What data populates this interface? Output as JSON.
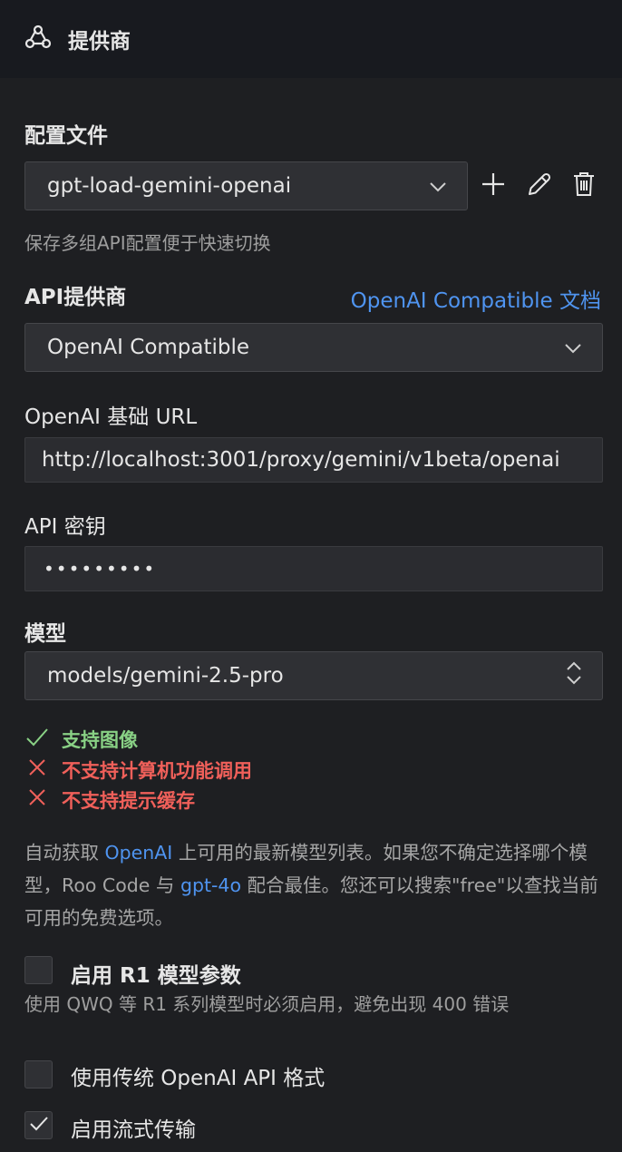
{
  "header": {
    "title": "提供商",
    "icon": "webhook-icon"
  },
  "config_file": {
    "label": "配置文件",
    "selected": "gpt-load-gemini-openai",
    "hint": "保存多组API配置便于快速切换"
  },
  "api_provider": {
    "label": "API提供商",
    "doc_link": "OpenAI Compatible 文档",
    "selected": "OpenAI Compatible"
  },
  "base_url": {
    "label": "OpenAI 基础 URL",
    "value": "http://localhost:3001/proxy/gemini/v1beta/openai"
  },
  "api_key": {
    "label": "API 密钥",
    "value": "•••••••••"
  },
  "model": {
    "label": "模型",
    "selected": "models/gemini-2.5-pro"
  },
  "capabilities": [
    {
      "text": "支持图像",
      "supported": true,
      "color": "#89d185"
    },
    {
      "text": "不支持计算机功能调用",
      "supported": false,
      "color": "#f0605a"
    },
    {
      "text": "不支持提示缓存",
      "supported": false,
      "color": "#f0605a"
    }
  ],
  "description": {
    "p1": "自动获取 ",
    "link1": "OpenAI",
    "p2": " 上可用的最新模型列表。如果您不确定选择哪个模型，Roo Code 与 ",
    "link2": "gpt-4o",
    "p3": " 配合最佳。您还可以搜索\"free\"以查找当前可用的免费选项。"
  },
  "r1": {
    "label": "启用 R1 模型参数",
    "hint": "使用 QWQ 等 R1 系列模型时必须启用，避免出现 400 错误",
    "checked": false
  },
  "legacy_format": {
    "label": "使用传统 OpenAI API 格式",
    "checked": false
  },
  "streaming": {
    "label": "启用流式传输",
    "checked": true
  },
  "colors": {
    "accent": "#4f94f0",
    "success": "#89d185",
    "error": "#f0605a"
  }
}
